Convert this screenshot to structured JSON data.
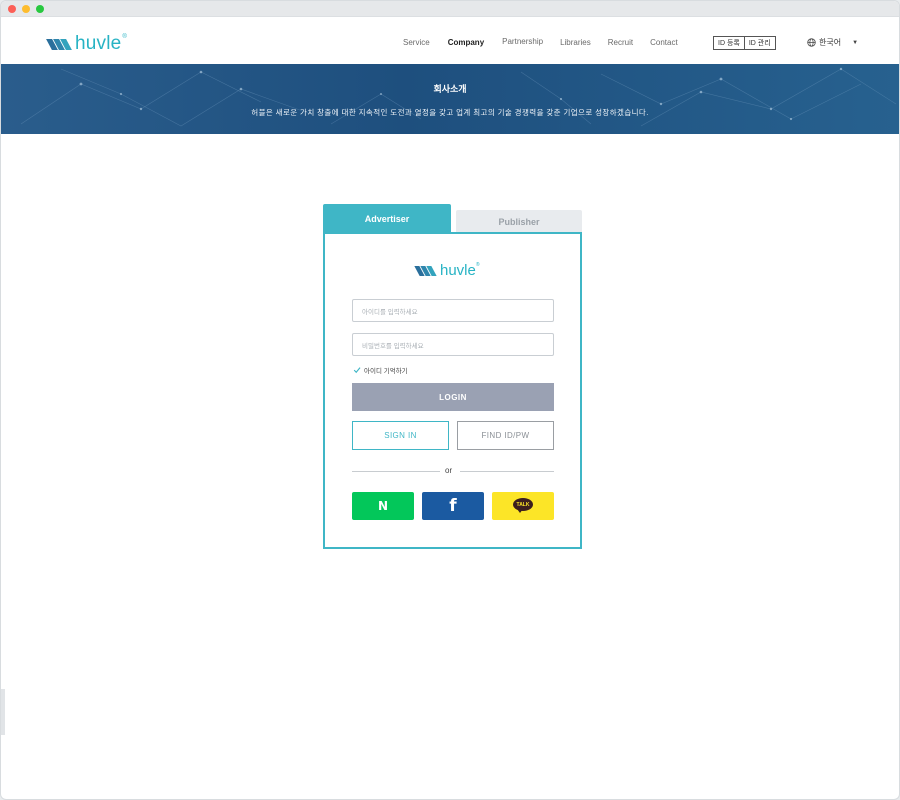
{
  "header": {
    "logo_text": "huvle",
    "logo_reg": "®",
    "nav": [
      {
        "label": "Service",
        "active": false
      },
      {
        "label": "Company",
        "active": true
      },
      {
        "label": "Partnership",
        "active": false
      },
      {
        "label": "Libraries",
        "active": false
      },
      {
        "label": "Recruit",
        "active": false
      },
      {
        "label": "Contact",
        "active": false
      }
    ],
    "id_register": "ID 등록",
    "id_manage": "ID 관리",
    "language": "한국어"
  },
  "hero": {
    "title": "회사소개",
    "subtitle": "허블은 새로운 가치 창출에 대한 지속적인 도전과 열정을 갖고 업계 최고의 기술 경쟁력을 갖춘 기업으로 성장하겠습니다."
  },
  "login": {
    "tabs": {
      "advertiser": "Advertiser",
      "publisher": "Publisher"
    },
    "active_tab": "Advertiser",
    "logo_text": "huvle",
    "logo_reg": "®",
    "id_placeholder": "아이디를 입력하세요",
    "pw_placeholder": "비밀번호를 입력하세요",
    "remember_label": "아이디 기억하기",
    "remember_checked": true,
    "login_button": "LOGIN",
    "signin_button": "SIGN IN",
    "find_button": "FIND ID/PW",
    "or_text": "or",
    "social": {
      "naver": "N",
      "facebook": "f",
      "kakao": "TALK"
    }
  },
  "colors": {
    "accent": "#3fb6c6",
    "login_button": "#9aa1b3",
    "naver": "#03c75a",
    "facebook": "#1b5aa1",
    "kakao": "#fce527",
    "hero": "#1e4f7e"
  }
}
